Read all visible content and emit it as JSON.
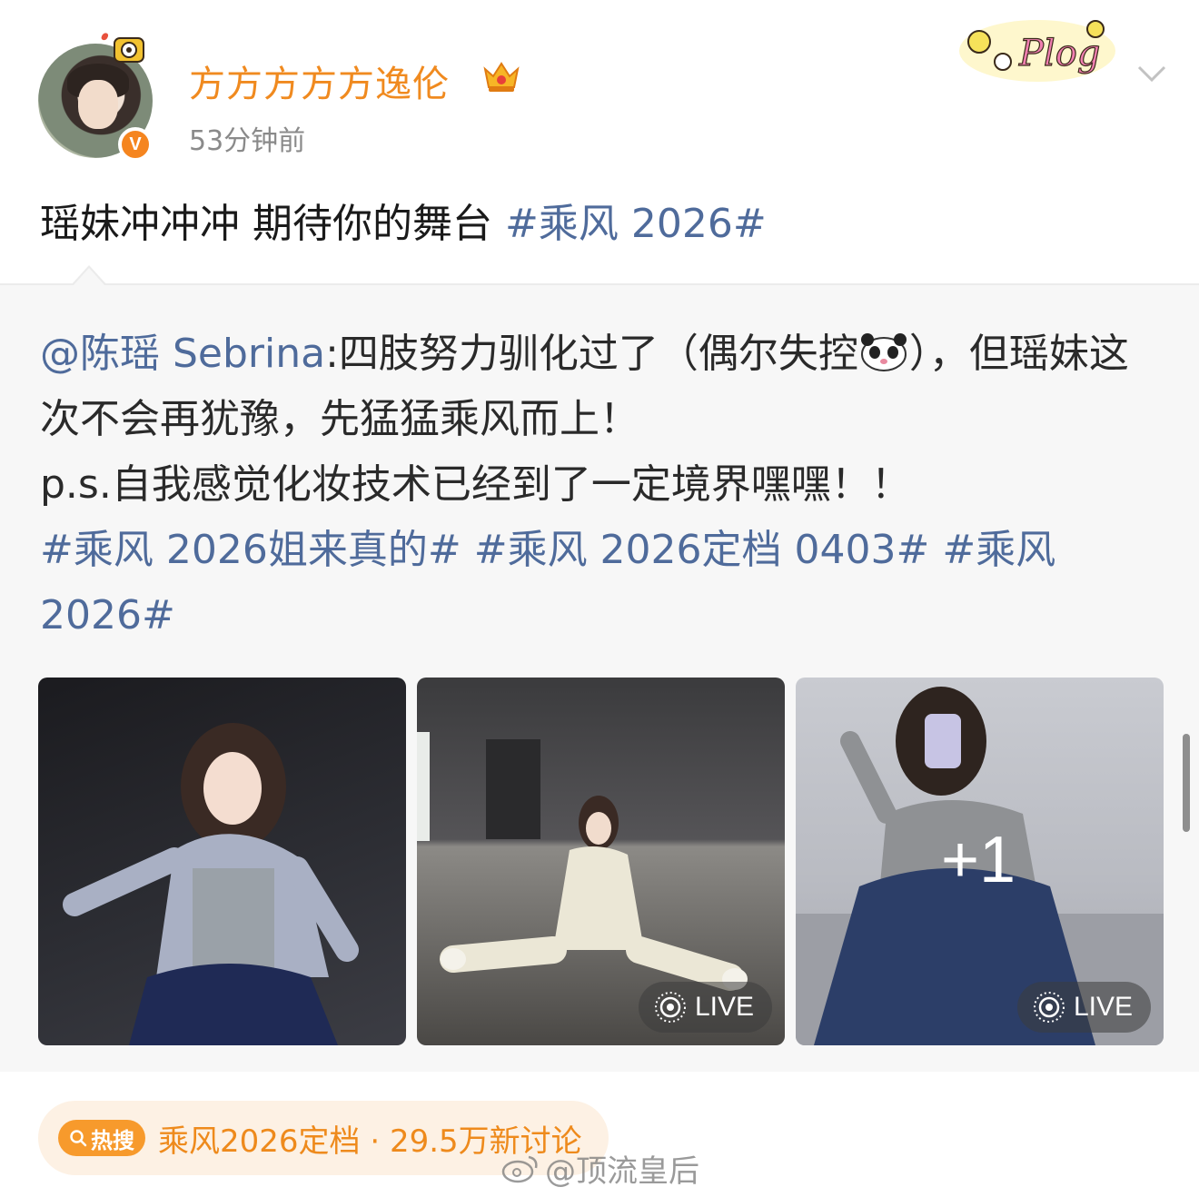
{
  "post": {
    "author": "方方方方方逸伦",
    "time": "53分钟前",
    "text": "瑶妹冲冲冲 期待你的舞台 ",
    "topic": "#乘风 2026#"
  },
  "stickers": {
    "plog": "Plog"
  },
  "repost": {
    "mention": "@陈瑶 Sebrina",
    "line1": ":四肢努力驯化过了（偶尔失控",
    "line1_end": "），但瑶妹这次不会再犹豫，先猛猛乘风而上！",
    "line2": "p.s.自我感觉化妆技术已经到了一定境界嘿嘿！！",
    "topics": [
      "#乘风 2026姐来真的#",
      "#乘风 2026定档 0403#",
      "#乘风 2026#"
    ]
  },
  "photos": [
    {
      "live": ""
    },
    {
      "live": "LIVE"
    },
    {
      "live": "LIVE",
      "more": "+1"
    }
  ],
  "hot_search": {
    "tag": "热搜",
    "label": "乘风2026定档 · 29.5万新讨论"
  },
  "watermark": "@顶流皇后",
  "colors": {
    "accent_orange": "#f08a1f",
    "topic_blue": "#4f6b9b",
    "hot_bg": "#fdf1e4"
  }
}
